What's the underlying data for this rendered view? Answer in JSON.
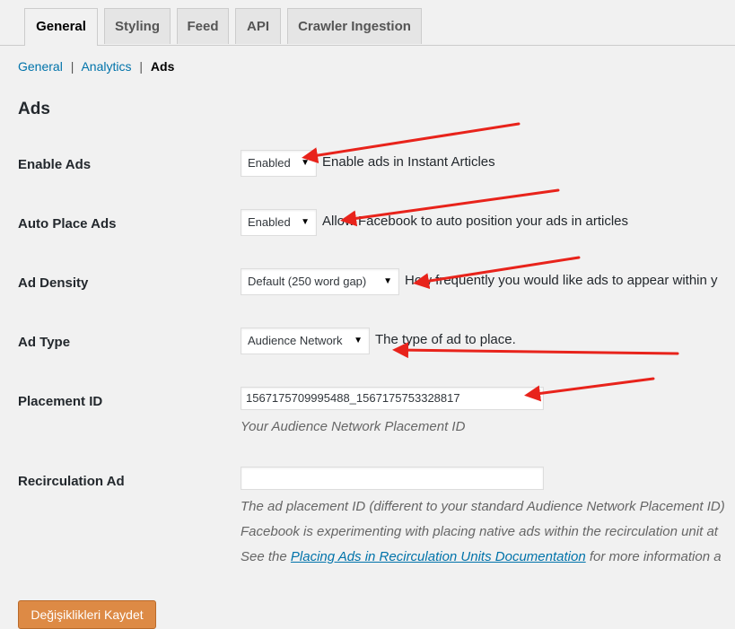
{
  "tabs": [
    {
      "label": "General",
      "active": true
    },
    {
      "label": "Styling"
    },
    {
      "label": "Feed"
    },
    {
      "label": "API"
    },
    {
      "label": "Crawler Ingestion"
    }
  ],
  "subnav": {
    "general": "General",
    "separator": "|",
    "analytics": "Analytics",
    "ads": "Ads"
  },
  "section_title": "Ads",
  "fields": {
    "enable_ads": {
      "label": "Enable Ads",
      "value": "Enabled",
      "description": "Enable ads in Instant Articles"
    },
    "auto_place_ads": {
      "label": "Auto Place Ads",
      "value": "Enabled",
      "description": "Allow Facebook to auto position your ads in articles"
    },
    "ad_density": {
      "label": "Ad Density",
      "value": "Default (250 word gap)",
      "description": "How frequently you would like ads to appear within y"
    },
    "ad_type": {
      "label": "Ad Type",
      "value": "Audience Network",
      "description": "The type of ad to place."
    },
    "placement_id": {
      "label": "Placement ID",
      "value": "1567175709995488_1567175753328817",
      "help": "Your Audience Network Placement ID"
    },
    "recirculation_ad": {
      "label": "Recirculation Ad",
      "value": "",
      "help_line1": "The ad placement ID (different to your standard Audience Network Placement ID)",
      "help_line2": "Facebook is experimenting with placing native ads within the recirculation unit at",
      "help_line3_prefix": "See the ",
      "help_line3_link": "Placing Ads in Recirculation Units Documentation",
      "help_line3_suffix": " for more information a"
    }
  },
  "save_button": "Değişiklikleri Kaydet",
  "colors": {
    "accent_link": "#0073aa",
    "save_button": "#dd8a45",
    "annotation_arrow": "#e8231b"
  }
}
